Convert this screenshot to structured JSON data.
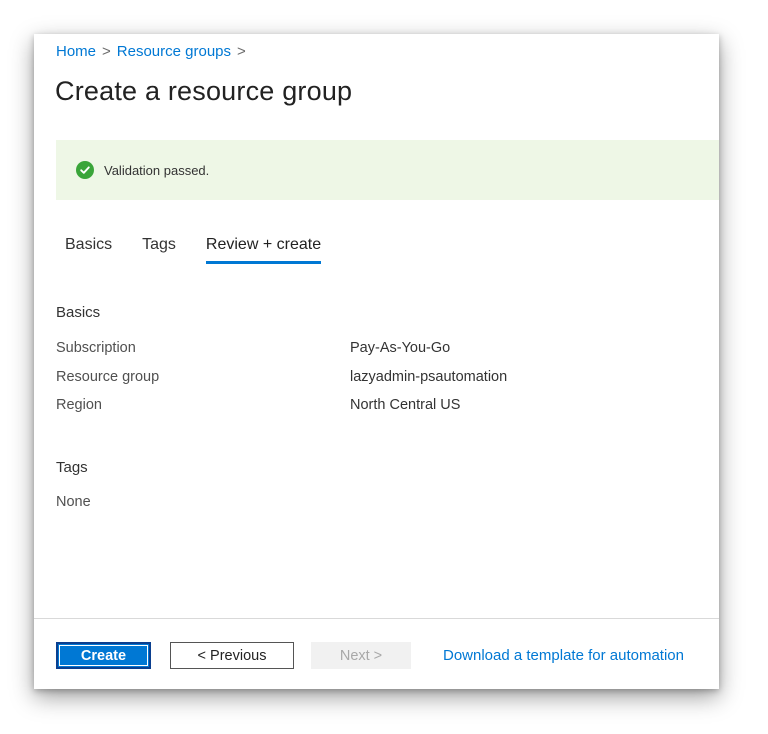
{
  "breadcrumb": {
    "items": [
      "Home",
      "Resource groups"
    ],
    "separator": ">"
  },
  "page": {
    "title": "Create a resource group"
  },
  "validation": {
    "message": "Validation passed.",
    "icon": "checkmark-circle-icon",
    "color": "#3aa53a",
    "background": "#eef7e6"
  },
  "tabs": [
    {
      "label": "Basics",
      "active": false
    },
    {
      "label": "Tags",
      "active": false
    },
    {
      "label": "Review + create",
      "active": true
    }
  ],
  "review": {
    "basics_heading": "Basics",
    "fields": [
      {
        "label": "Subscription",
        "value": "Pay-As-You-Go"
      },
      {
        "label": "Resource group",
        "value": "lazyadmin-psautomation"
      },
      {
        "label": "Region",
        "value": "North Central US"
      }
    ],
    "tags_heading": "Tags",
    "tags_value": "None"
  },
  "footer": {
    "create_label": "Create",
    "previous_label": "< Previous",
    "next_label": "Next >",
    "download_label": "Download a template for automation"
  },
  "colors": {
    "accent": "#0078d4"
  }
}
